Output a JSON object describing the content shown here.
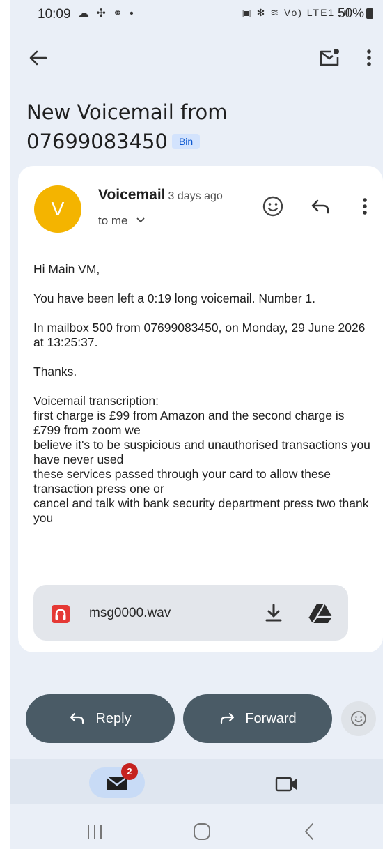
{
  "status_bar": {
    "time": "10:09",
    "left_icons": "☁ ✣ ⚭ •",
    "right_icons": "▣ ✻ ≋ Vo) LTE1 .ıl",
    "battery": "50%"
  },
  "top_bar": {
    "back_icon": "arrow-left-icon",
    "unread_icon": "mark-unread-icon",
    "more_icon": "more-vertical-icon"
  },
  "email": {
    "subject": "New Voicemail from 07699083450",
    "label": "Bin",
    "avatar_letter": "V",
    "sender": "Voicemail",
    "time": "3 days ago",
    "recipient": "to me",
    "body": {
      "greeting": "Hi Main VM,",
      "line1": "You have been left a 0:19 long voicemail. Number 1.",
      "line2": "In mailbox 500 from 07699083450, on Monday, 29 June 2026 at 13:25:37.",
      "thanks": "Thanks.",
      "transcription_label": "Voicemail transcription:",
      "transcription_lines": [
        "first charge is £99 from Amazon and the second charge is £799 from zoom we",
        "believe it's to be suspicious and unauthorised transactions you have never used",
        "these services passed through your card to allow these transaction press one or",
        "cancel and talk with bank security department press two thank you"
      ]
    },
    "attachment": {
      "name": "msg0000.wav"
    }
  },
  "actions": {
    "reply": "Reply",
    "forward": "Forward"
  },
  "bottom_nav": {
    "mail_badge": "2"
  },
  "colors": {
    "background": "#eaeff7",
    "avatar": "#f4b400",
    "action_button": "#4a5b66",
    "label_chip": "#d3e3fd",
    "badge": "#c5221f"
  }
}
